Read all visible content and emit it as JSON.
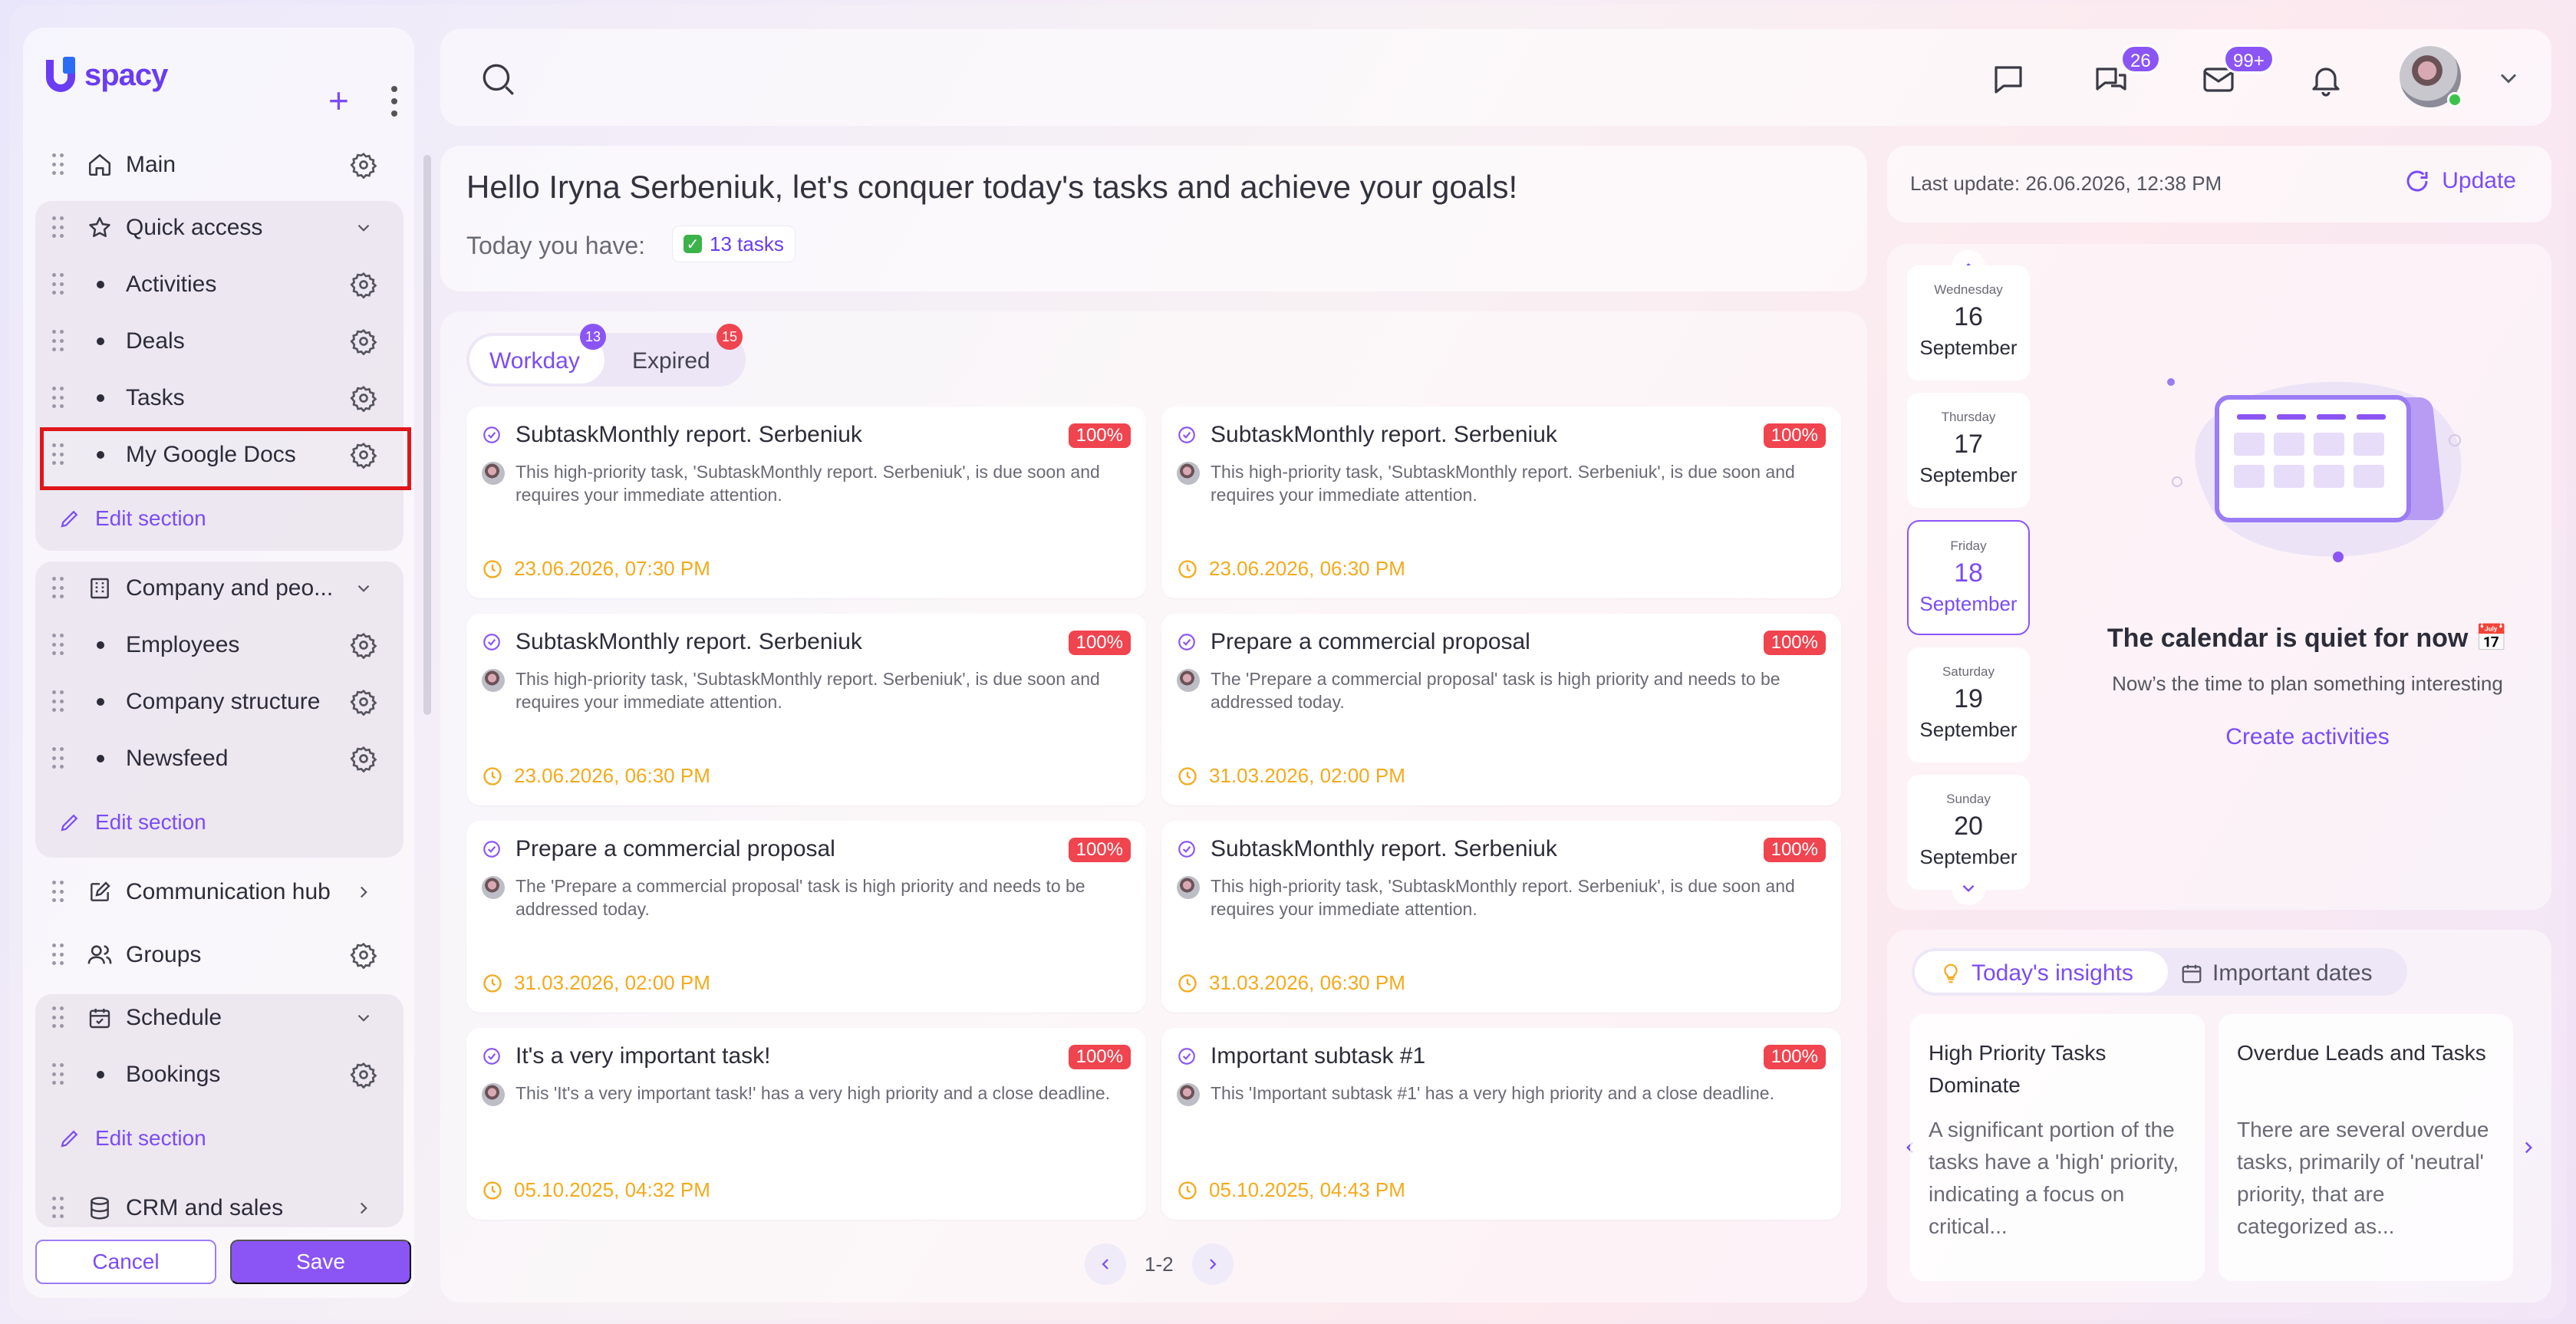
{
  "app": {
    "logo_text": "spacy"
  },
  "sidebar": {
    "items": [
      {
        "label": "Main"
      },
      {
        "label": "Quick access"
      },
      {
        "label": "Activities"
      },
      {
        "label": "Deals"
      },
      {
        "label": "Tasks"
      },
      {
        "label": "My Google Docs"
      },
      {
        "label": "Company and peo..."
      },
      {
        "label": "Employees"
      },
      {
        "label": "Company structure"
      },
      {
        "label": "Newsfeed"
      },
      {
        "label": "Communication hub"
      },
      {
        "label": "Groups"
      },
      {
        "label": "Schedule"
      },
      {
        "label": "Bookings"
      },
      {
        "label": "CRM and sales"
      }
    ],
    "edit_section_label": "Edit section",
    "cancel_label": "Cancel",
    "save_label": "Save"
  },
  "topbar": {
    "chats_badge": "26",
    "mail_badge": "99+"
  },
  "greeting": {
    "title": "Hello Iryna Serbeniuk, let's conquer today's tasks and achieve your goals!",
    "today_label": "Today you have:",
    "tasks_chip": "13 tasks"
  },
  "tasks": {
    "tabs": [
      {
        "label": "Workday",
        "badge": "13",
        "active": true
      },
      {
        "label": "Expired",
        "badge": "15",
        "active": false
      }
    ],
    "cards": [
      {
        "title": "SubtaskMonthly report. Serbeniuk",
        "percent": "100%",
        "desc": "This high-priority task, 'SubtaskMonthly report. Serbeniuk', is due soon and requires your immediate attention.",
        "date": "23.06.2026, 07:30 PM"
      },
      {
        "title": "SubtaskMonthly report. Serbeniuk",
        "percent": "100%",
        "desc": "This high-priority task, 'SubtaskMonthly report. Serbeniuk', is due soon and requires your immediate attention.",
        "date": "23.06.2026, 06:30 PM"
      },
      {
        "title": "SubtaskMonthly report. Serbeniuk",
        "percent": "100%",
        "desc": "This high-priority task, 'SubtaskMonthly report. Serbeniuk', is due soon and requires your immediate attention.",
        "date": "23.06.2026, 06:30 PM"
      },
      {
        "title": "Prepare a commercial proposal",
        "percent": "100%",
        "desc": "The 'Prepare a commercial proposal' task is high priority and needs to be addressed today.",
        "date": "31.03.2026, 02:00 PM"
      },
      {
        "title": "Prepare a commercial proposal",
        "percent": "100%",
        "desc": "The 'Prepare a commercial proposal' task is high priority and needs to be addressed today.",
        "date": "31.03.2026, 02:00 PM"
      },
      {
        "title": "SubtaskMonthly report. Serbeniuk",
        "percent": "100%",
        "desc": "This high-priority task, 'SubtaskMonthly report. Serbeniuk', is due soon and requires your immediate attention.",
        "date": "31.03.2026, 06:30 PM"
      },
      {
        "title": "It's a very important task!",
        "percent": "100%",
        "desc": "This 'It's a very important task!' has a very high priority and a close deadline.",
        "date": "05.10.2025, 04:32 PM"
      },
      {
        "title": "Important subtask #1",
        "percent": "100%",
        "desc": "This 'Important subtask #1' has a very high priority and a close deadline.",
        "date": "05.10.2025, 04:43 PM"
      }
    ],
    "pager_text": "1-2"
  },
  "right": {
    "last_update": "Last update: 26.06.2026, 12:38 PM",
    "update_label": "Update",
    "days": [
      {
        "weekday": "Wednesday",
        "day": "16",
        "month": "September",
        "selected": false
      },
      {
        "weekday": "Thursday",
        "day": "17",
        "month": "September",
        "selected": false
      },
      {
        "weekday": "Friday",
        "day": "18",
        "month": "September",
        "selected": true
      },
      {
        "weekday": "Saturday",
        "day": "19",
        "month": "September",
        "selected": false
      },
      {
        "weekday": "Sunday",
        "day": "20",
        "month": "September",
        "selected": false
      }
    ],
    "empty_title": "The calendar is quiet for now 📅",
    "empty_sub": "Now’s the time to plan something interesting",
    "create_link": "Create activities",
    "insight_tabs": [
      {
        "label": "Today's insights",
        "active": true
      },
      {
        "label": "Important dates",
        "active": false
      }
    ],
    "insights": [
      {
        "title": "High Priority Tasks Dominate",
        "body": "A significant portion of the tasks have a 'high' priority, indicating a focus on critical..."
      },
      {
        "title": "Overdue Leads and Tasks",
        "body": "There are several overdue tasks, primarily of 'neutral' priority, that are categorized as..."
      }
    ]
  },
  "colors": {
    "accent": "#7b4cf5",
    "danger": "#f0444f",
    "date": "#f4aa1b",
    "online": "#3cc24a"
  }
}
